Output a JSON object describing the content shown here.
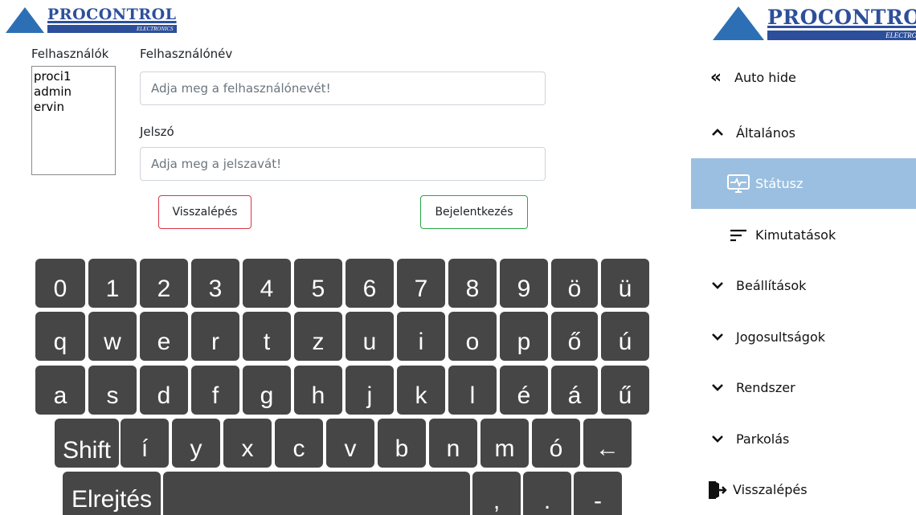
{
  "logo": {
    "name": "PROCONTROL",
    "sub": "ELECTRONICS",
    "registered": "®"
  },
  "form": {
    "users_label": "Felhasználók",
    "users": [
      "proci1",
      "admin",
      "ervin"
    ],
    "username_label": "Felhasználónév",
    "username_placeholder": "Adja meg a felhasználónevét!",
    "password_label": "Jelszó",
    "password_placeholder": "Adja meg a jelszavát!",
    "back_button": "Visszalépés",
    "login_button": "Bejelentkezés"
  },
  "keyboard": {
    "row1": [
      "0",
      "1",
      "2",
      "3",
      "4",
      "5",
      "6",
      "7",
      "8",
      "9",
      "ö",
      "ü"
    ],
    "row2": [
      "q",
      "w",
      "e",
      "r",
      "t",
      "z",
      "u",
      "i",
      "o",
      "p",
      "ő",
      "ú"
    ],
    "row3": [
      "a",
      "s",
      "d",
      "f",
      "g",
      "h",
      "j",
      "k",
      "l",
      "é",
      "á",
      "ű"
    ],
    "row4": [
      "Shift",
      "í",
      "y",
      "x",
      "c",
      "v",
      "b",
      "n",
      "m",
      "ó",
      "←"
    ],
    "row5": [
      "Elrejtés",
      "",
      ",",
      ".",
      "-"
    ]
  },
  "sidebar": {
    "auto_hide": "Auto hide",
    "items": [
      {
        "label": "Általános",
        "icon": "chevron-up-icon"
      },
      {
        "label": "Státusz",
        "icon": "monitor-pulse-icon"
      },
      {
        "label": "Kimutatások",
        "icon": "sort-lines-icon"
      },
      {
        "label": "Beállítások",
        "icon": "chevron-down-icon"
      },
      {
        "label": "Jogosultságok",
        "icon": "chevron-down-icon"
      },
      {
        "label": "Rendszer",
        "icon": "chevron-down-icon"
      },
      {
        "label": "Parkolás",
        "icon": "chevron-down-icon"
      },
      {
        "label": "Visszalépés",
        "icon": "exit-door-icon"
      }
    ],
    "active_color": "#9bbfe0"
  }
}
